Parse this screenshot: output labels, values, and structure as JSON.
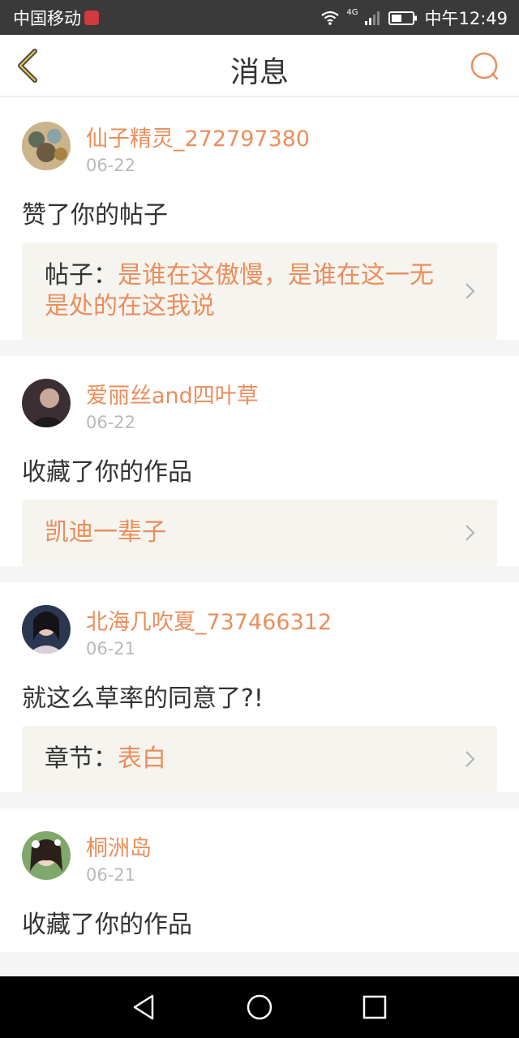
{
  "status_bar": {
    "carrier": "中国移动",
    "network": "4G",
    "time": "中午12:49"
  },
  "header": {
    "title": "消息",
    "back_icon": "chevron-left-icon",
    "search_icon": "search-icon",
    "accent": "#eb8e5c"
  },
  "messages": [
    {
      "username": "仙子精灵_272797380",
      "date": "06-22",
      "action": "赞了你的帖子",
      "ref_prefix": "帖子：",
      "ref_text": "是谁在这傲慢，是谁在这一无是处的在这我说"
    },
    {
      "username": "爱丽丝and四叶草",
      "date": "06-22",
      "action": "收藏了你的作品",
      "ref_prefix": "",
      "ref_text": "凯迪一辈子"
    },
    {
      "username": "北海几吹夏_737466312",
      "date": "06-21",
      "action": "就这么草率的同意了?!",
      "ref_prefix": "章节：",
      "ref_text": "表白"
    },
    {
      "username": "桐洲岛",
      "date": "06-21",
      "action": "收藏了你的作品"
    }
  ],
  "nav": {
    "back_icon": "triangle-back-icon",
    "home_icon": "circle-home-icon",
    "recents_icon": "square-recents-icon"
  }
}
